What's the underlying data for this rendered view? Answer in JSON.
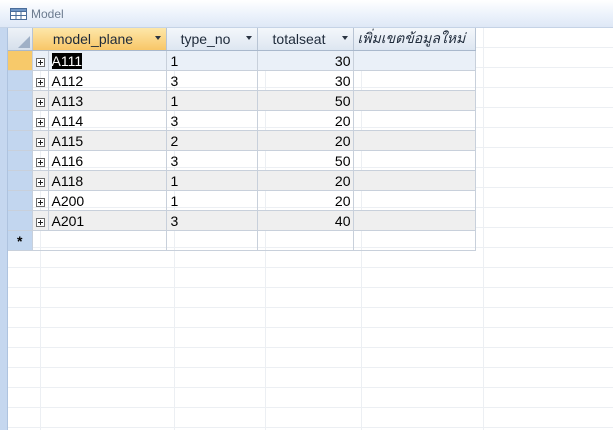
{
  "window": {
    "title": "Model"
  },
  "columns": [
    "model_plane",
    "type_no",
    "totalseat",
    "เพิ่มเขตข้อมูลใหม่"
  ],
  "rows": [
    {
      "model_plane": "A111",
      "type_no": "1",
      "totalseat": "30"
    },
    {
      "model_plane": "A112",
      "type_no": "3",
      "totalseat": "30"
    },
    {
      "model_plane": "A113",
      "type_no": "1",
      "totalseat": "50"
    },
    {
      "model_plane": "A114",
      "type_no": "3",
      "totalseat": "20"
    },
    {
      "model_plane": "A115",
      "type_no": "2",
      "totalseat": "20"
    },
    {
      "model_plane": "A116",
      "type_no": "3",
      "totalseat": "50"
    },
    {
      "model_plane": "A118",
      "type_no": "1",
      "totalseat": "20"
    },
    {
      "model_plane": "A200",
      "type_no": "1",
      "totalseat": "20"
    },
    {
      "model_plane": "A201",
      "type_no": "3",
      "totalseat": "40"
    }
  ],
  "new_record_marker": "*",
  "colors": {
    "header_active": "#f8c667",
    "selector": "#c2d6ef",
    "title_text": "#6c7b8f"
  }
}
